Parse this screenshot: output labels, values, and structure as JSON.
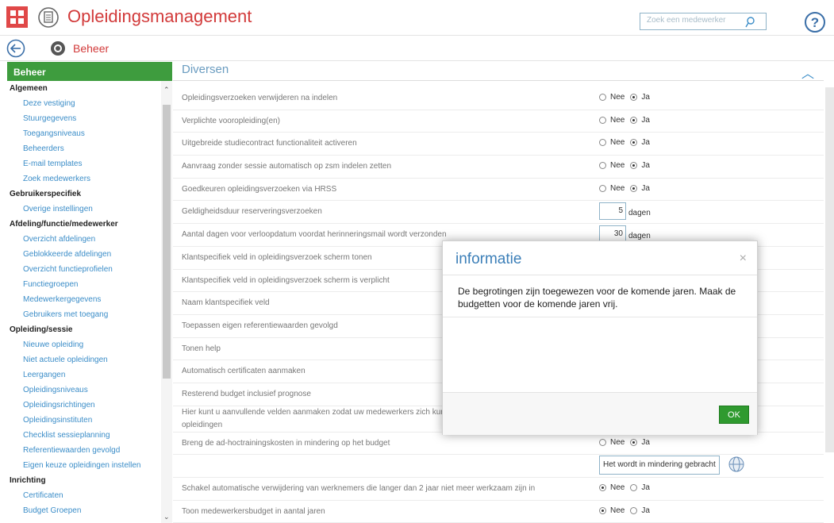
{
  "app": {
    "title": "Opleidingsmanagement"
  },
  "search": {
    "placeholder": "Zoek een medewerker"
  },
  "subbar": {
    "title": "Beheer"
  },
  "sidebar": {
    "header": "Beheer",
    "items": [
      {
        "type": "cat",
        "label": "Algemeen"
      },
      {
        "type": "link",
        "label": "Deze vestiging"
      },
      {
        "type": "link",
        "label": "Stuurgegevens"
      },
      {
        "type": "link",
        "label": "Toegangsniveaus"
      },
      {
        "type": "link",
        "label": "Beheerders"
      },
      {
        "type": "link",
        "label": "E-mail templates"
      },
      {
        "type": "link",
        "label": "Zoek medewerkers"
      },
      {
        "type": "cat",
        "label": "Gebruikerspecifiek"
      },
      {
        "type": "link",
        "label": "Overige instellingen"
      },
      {
        "type": "cat",
        "label": "Afdeling/functie/medewerker"
      },
      {
        "type": "link",
        "label": "Overzicht afdelingen"
      },
      {
        "type": "link",
        "label": "Geblokkeerde afdelingen"
      },
      {
        "type": "link",
        "label": "Overzicht functieprofielen"
      },
      {
        "type": "link",
        "label": "Functiegroepen"
      },
      {
        "type": "link",
        "label": "Medewerkergegevens"
      },
      {
        "type": "link",
        "label": "Gebruikers met toegang"
      },
      {
        "type": "cat",
        "label": "Opleiding/sessie"
      },
      {
        "type": "link",
        "label": "Nieuwe opleiding"
      },
      {
        "type": "link",
        "label": "Niet actuele opleidingen"
      },
      {
        "type": "link",
        "label": "Leergangen"
      },
      {
        "type": "link",
        "label": "Opleidingsniveaus"
      },
      {
        "type": "link",
        "label": "Opleidingsrichtingen"
      },
      {
        "type": "link",
        "label": "Opleidingsinstituten"
      },
      {
        "type": "link",
        "label": "Checklist sessieplanning"
      },
      {
        "type": "link",
        "label": "Referentiewaarden gevolgd"
      },
      {
        "type": "link",
        "label": "Eigen keuze opleidingen instellen"
      },
      {
        "type": "cat",
        "label": "Inrichting"
      },
      {
        "type": "link",
        "label": "Certificaten"
      },
      {
        "type": "link",
        "label": "Budget Groepen"
      }
    ]
  },
  "section": {
    "title": "Diversen"
  },
  "rows": [
    {
      "label": "Opleidingsverzoeken verwijderen na indelen",
      "kind": "radio",
      "nee": "Nee",
      "ja": "Ja",
      "selected": "ja"
    },
    {
      "label": "Verplichte vooropleiding(en)",
      "kind": "radio",
      "nee": "Nee",
      "ja": "Ja",
      "selected": "ja"
    },
    {
      "label": "Uitgebreide studiecontract functionaliteit activeren",
      "kind": "radio",
      "nee": "Nee",
      "ja": "Ja",
      "selected": "ja"
    },
    {
      "label": "Aanvraag zonder sessie automatisch op zsm indelen zetten",
      "kind": "radio",
      "nee": "Nee",
      "ja": "Ja",
      "selected": "ja"
    },
    {
      "label": "Goedkeuren opleidingsverzoeken via HRSS",
      "kind": "radio",
      "nee": "Nee",
      "ja": "Ja",
      "selected": "ja"
    },
    {
      "label": "Geldigheidsduur reserveringsverzoeken",
      "kind": "number",
      "value": "5",
      "unit": "dagen"
    },
    {
      "label": "Aantal dagen voor verloopdatum voordat herinneringsmail wordt verzonden",
      "kind": "number",
      "value": "30",
      "unit": "dagen"
    },
    {
      "label": "Klantspecifiek veld in opleidingsverzoek scherm tonen",
      "kind": "none"
    },
    {
      "label": "Klantspecifiek veld in opleidingsverzoek scherm is verplicht",
      "kind": "none"
    },
    {
      "label": "Naam klantspecifiek veld",
      "kind": "none"
    },
    {
      "label": "Toepassen eigen referentiewaarden gevolgd",
      "kind": "none"
    },
    {
      "label": "Tonen help",
      "kind": "none"
    },
    {
      "label": "Automatisch certificaten aanmaken",
      "kind": "none"
    },
    {
      "label": "Resterend budget inclusief prognose",
      "kind": "none"
    },
    {
      "label": "Hier kunt u aanvullende velden aanmaken zodat uw medewerkers zich kun",
      "label2": "opleidingen",
      "kind": "none"
    },
    {
      "label": "Breng de ad-hoctrainingskosten in mindering op het budget",
      "kind": "radio",
      "nee": "Nee",
      "ja": "Ja",
      "selected": "ja"
    },
    {
      "label": "",
      "kind": "text",
      "value": "Het wordt in mindering gebracht"
    },
    {
      "label": "Schakel automatische verwijdering van werknemers die langer dan 2 jaar niet meer werkzaam zijn in",
      "kind": "radio",
      "nee": "Nee",
      "ja": "Ja",
      "selected": "nee"
    },
    {
      "label": "Toon medewerkersbudget in aantal jaren",
      "kind": "radio",
      "nee": "Nee",
      "ja": "Ja",
      "selected": "nee"
    }
  ],
  "modal": {
    "title": "informatie",
    "close": "×",
    "body": "De begrotingen zijn toegewezen voor de komende jaren. Maak de budgetten voor de komende jaren vrij.",
    "ok": "OK"
  },
  "colors": {
    "brand_red": "#d23a3a",
    "green": "#3e9c3e",
    "link_blue": "#3b8dc8"
  }
}
